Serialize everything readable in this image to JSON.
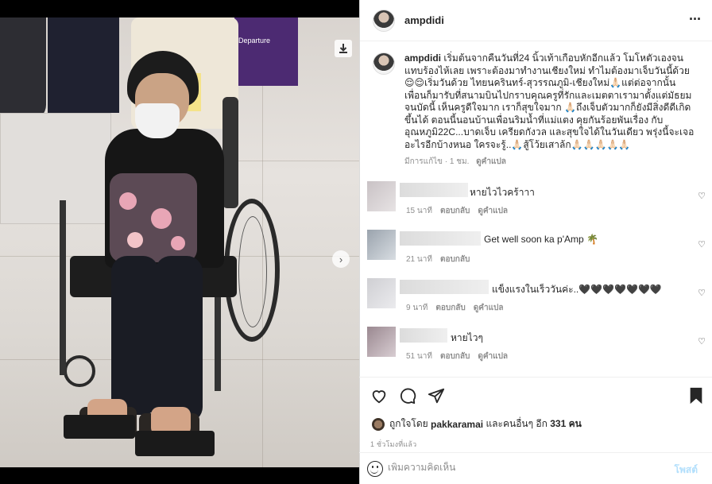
{
  "post": {
    "username": "ampdidi",
    "caption_username": "ampdidi",
    "caption_text": "เริ่มต้นจากคืนวันที่24 นิ้วเท้าเกือบหักอีกแล้ว โมโหตัวเองจนแทบร้องไห้เลย เพราะต้องมาทำงานเชียงใหม่ ทำไมต้องมาเจ็บวันนี้ด้วย😌😌เริ่มวันด้วย ไทยนครินทร์-สุวรรณภูมิ-เชียงใหม่🙏🏻แต่ต่อจากนั้น เพื่อนก็มารับที่สนามบินไปกราบคุณครูที่รักและเมตตาเรามาตั้งแต่มัธยมจนบัดนี้ เห็นครูดีใจมาก เราก็สุขใจมาก 🙏🏻ถึงเจ็บตัวมากก็ยังมีสิ่งดีดีเกิดขึ้นได้ ตอนนี้นอนบ้านเพื่อนริมน้ำที่แม่แตง คุยกันร้อยพันเรื่อง กับ อุณหภูมิ22C...บาดเจ็บ เครียดกังวล และสุขใจได้ในวันเดียว พรุ่งนี้จะเจออะไรอีกบ้างหนอ ใครจะรู้..🙏🏻สู้โว้ยเสาล้ก🙏🏻🙏🏻🙏🏻🙏🏻🙏🏻",
    "caption_meta": {
      "edited": "มีการแก้ไข · 1 ชม.",
      "translate": "ดูคำแปล"
    }
  },
  "photo": {
    "sign_text": "Departure",
    "carousel_dots": 8,
    "active_dot": 0
  },
  "comments": [
    {
      "text": "หายไวไวคร้าาา",
      "time": "15 นาที",
      "reply": "ตอบกลับ",
      "translate": "ดูคำแปล"
    },
    {
      "text": "Get well soon ka p'Amp 🌴",
      "time": "21 นาที",
      "reply": "ตอบกลับ",
      "translate": ""
    },
    {
      "text": "แข็งแรงในเร็ววันค่ะ..🖤🖤🖤🖤🖤🖤🖤",
      "time": "9 นาที",
      "reply": "ตอบกลับ",
      "translate": "ดูคำแปล"
    },
    {
      "text": "หายไวๆ",
      "time": "51 นาที",
      "reply": "ตอบกลับ",
      "translate": "ดูคำแปล"
    }
  ],
  "likes": {
    "prefix": "ถูกใจโดย",
    "liker": "pakkaramai",
    "suffix": "และคนอื่นๆ อีก",
    "count": "331 คน"
  },
  "timestamp": "1 ชั่วโมงที่แล้ว",
  "add_comment": {
    "placeholder": "เพิ่มความคิดเห็น",
    "post_label": "โพสต์"
  },
  "icons": {
    "more": "more-icon",
    "heart": "heart-icon",
    "comment": "comment-icon",
    "share": "share-icon",
    "save": "bookmark-icon",
    "emoji": "emoji-icon",
    "download": "download-icon",
    "next": "chevron-right-icon"
  },
  "colors": {
    "accent": "#0095f6",
    "post_disabled": "#b2dffc",
    "muted": "#8e8e8e",
    "active_dot": "#3b8de8"
  }
}
